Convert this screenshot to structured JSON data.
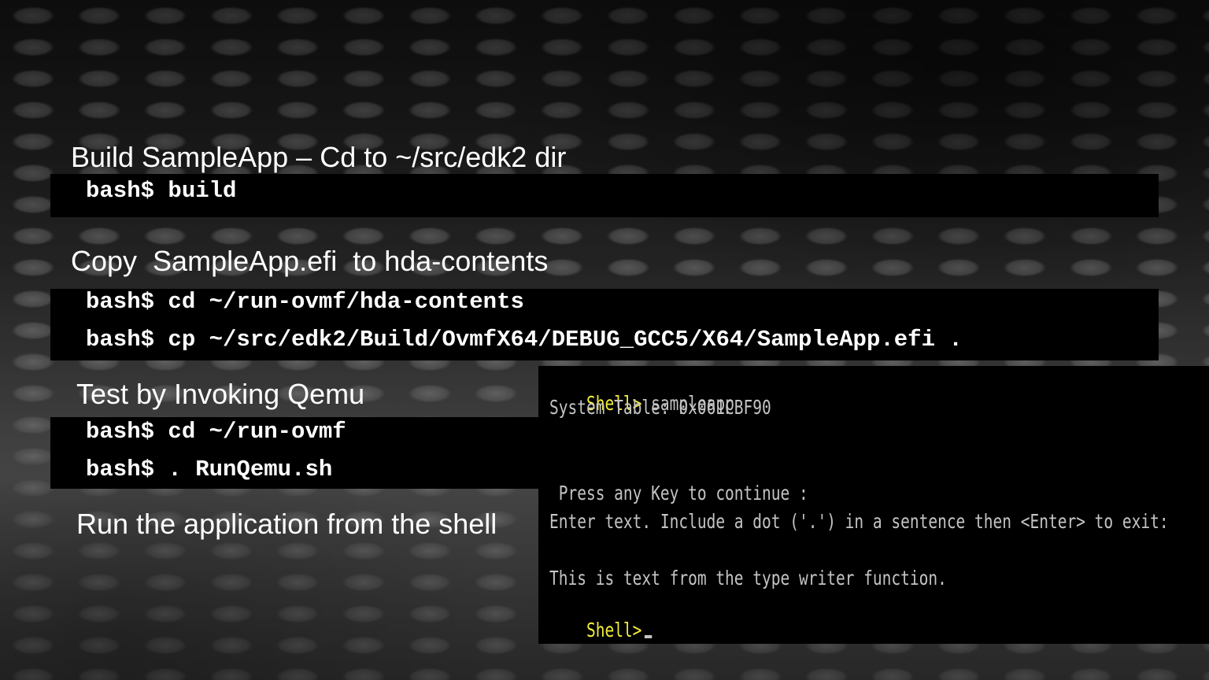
{
  "sections": {
    "build": {
      "heading": "Build SampleApp – Cd to ~/src/edk2 dir",
      "commands": [
        "bash$ build"
      ]
    },
    "copy": {
      "heading": "Copy  SampleApp.efi  to hda-contents",
      "commands": [
        "bash$ cd ~/run-ovmf/hda-contents",
        "bash$ cp ~/src/edk2/Build/OvmfX64/DEBUG_GCC5/X64/SampleApp.efi ."
      ]
    },
    "test": {
      "heading": "Test by Invoking Qemu",
      "commands": [
        "bash$ cd ~/run-ovmf",
        "bash$ . RunQemu.sh"
      ]
    },
    "run": {
      "heading": "Run the application from the shell"
    }
  },
  "terminal": {
    "prompt": "Shell>",
    "command": " sampleapp",
    "system_table": "System Table: 0x061CBF90",
    "press_key": " Press any Key to continue :",
    "enter_text": "Enter text. Include a dot ('.') in a sentence then <Enter> to exit:",
    "typed_text": "This is text from the type writer function.",
    "final_prompt": "Shell>",
    "prompt_color": "#f2ee3c",
    "text_color": "#c4c4c4"
  }
}
